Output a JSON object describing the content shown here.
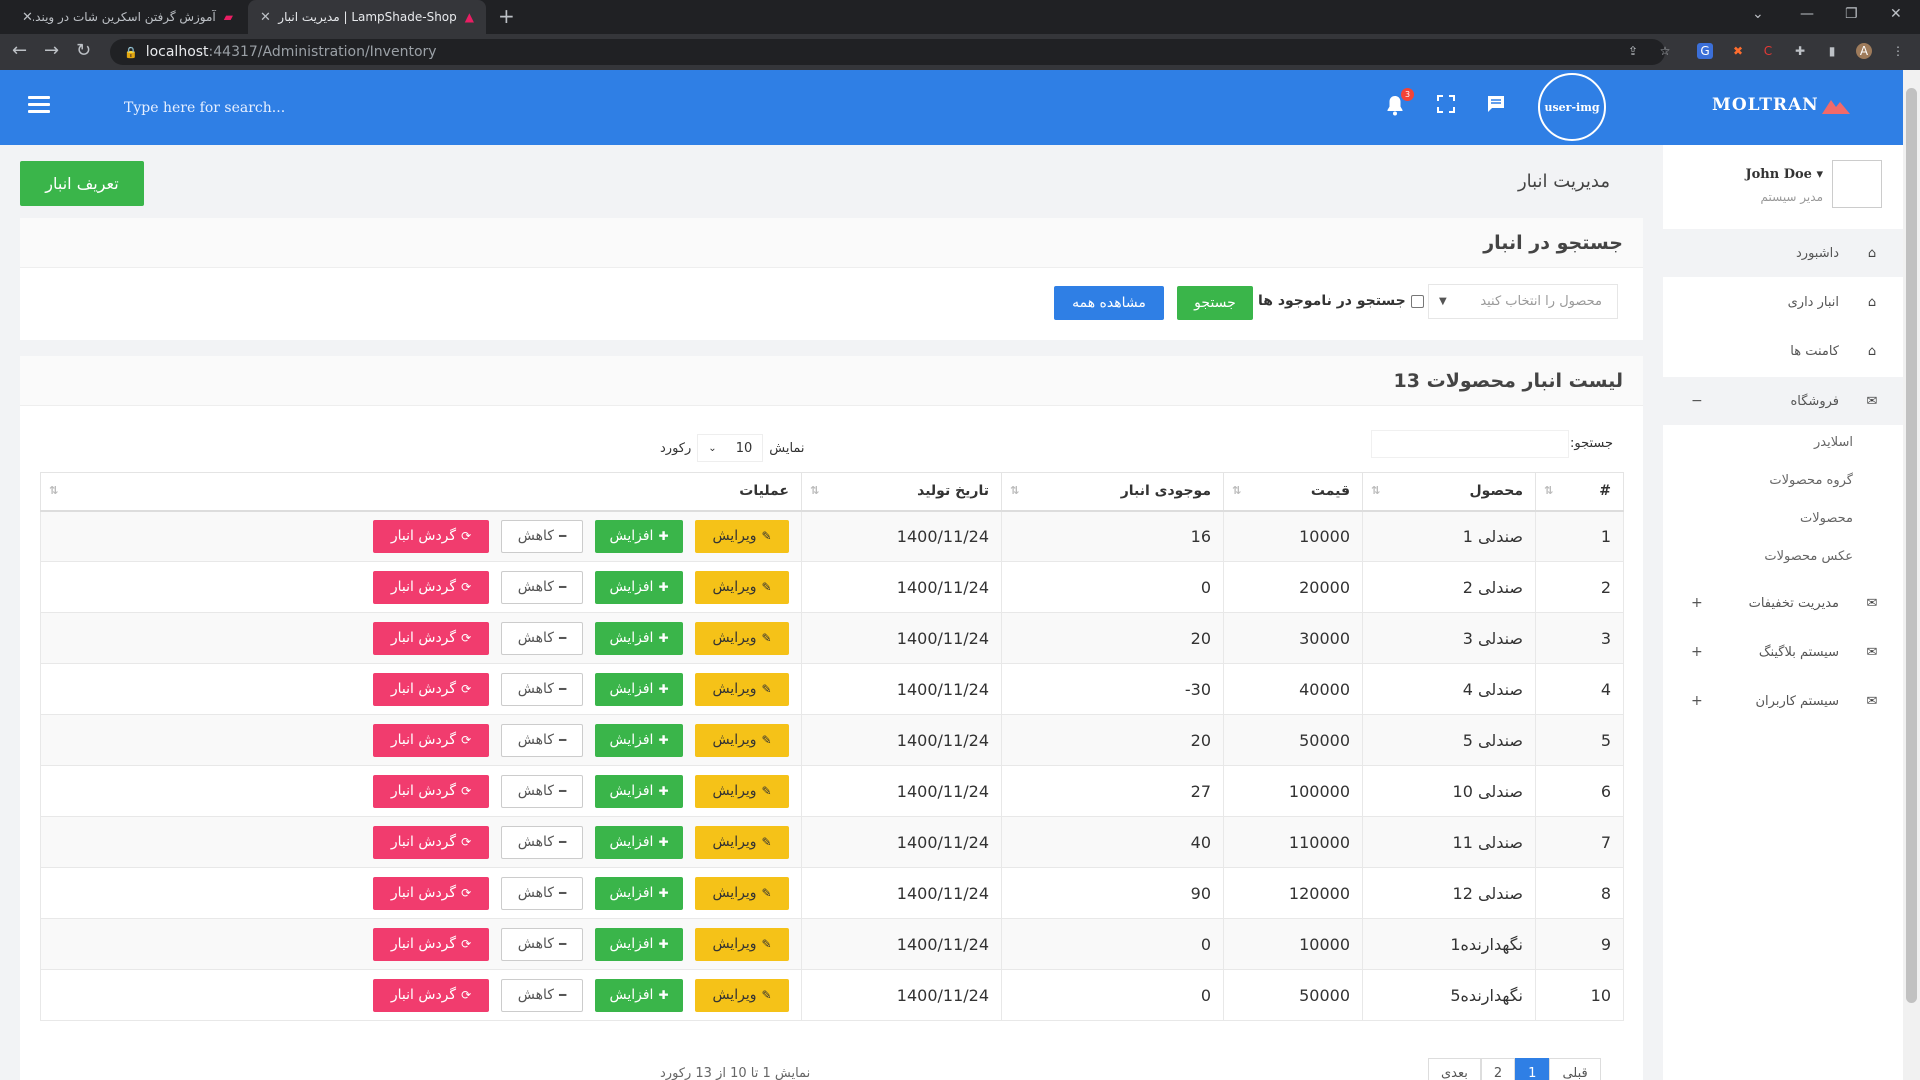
{
  "browser": {
    "tabs": [
      {
        "title": "آموزش گرفتن اسکرین شات در ویند..."
      },
      {
        "title": "LampShade-Shop | مدیریت انبار"
      }
    ],
    "url_host": "localhost",
    "url_path": ":44317/Administration/Inventory",
    "profile_initial": "A"
  },
  "header": {
    "search_placeholder": "Type here for search...",
    "notification_count": "3",
    "avatar_alt": "user-img",
    "brand": "MOLTRAN",
    "color": "#2f7fe5"
  },
  "sidebar": {
    "user_name": "John Doe",
    "user_role": "مدیر سیستم",
    "items": [
      {
        "label": "داشبورد",
        "icon": "home-icon"
      },
      {
        "label": "انبار داری",
        "icon": "home-icon"
      },
      {
        "label": "کامنت ها",
        "icon": "home-icon"
      },
      {
        "label": "فروشگاه",
        "icon": "envelope-icon",
        "toggle": "−"
      },
      {
        "label": "مدیریت تخفیفات",
        "icon": "envelope-icon",
        "toggle": "+"
      },
      {
        "label": "سیستم بلاگینگ",
        "icon": "envelope-icon",
        "toggle": "+"
      },
      {
        "label": "سیستم کاربران",
        "icon": "envelope-icon",
        "toggle": "+"
      }
    ],
    "shop_sub": [
      "اسلایدر",
      "گروه محصولات",
      "محصولات",
      "عکس محصولات"
    ]
  },
  "page": {
    "title": "مدیریت انبار",
    "define_button": "تعریف انبار"
  },
  "search_card": {
    "title": "جستجو در انبار",
    "product_select": "محصول را انتخاب کنید",
    "out_of_stock_label": "جستجو در ناموجود ها",
    "search_button": "جستجو",
    "show_all_button": "مشاهده همه"
  },
  "list_card": {
    "title": "لیست انبار محصولات 13",
    "search_label": "جستجو:",
    "show_label": "نمایش",
    "page_length": "10",
    "records_label": "رکورد",
    "columns": [
      "#",
      "محصول",
      "قیمت",
      "موجودی انبار",
      "تاریخ تولید",
      "عملیات"
    ],
    "actions": {
      "edit": "ویرایش",
      "increase": "افزایش",
      "decrease": "کاهش",
      "log": "گردش انبار"
    },
    "rows": [
      {
        "id": "1",
        "product": "صندلی 1",
        "price": "10000",
        "stock": "16",
        "date": "1400/11/24"
      },
      {
        "id": "2",
        "product": "صندلی 2",
        "price": "20000",
        "stock": "0",
        "date": "1400/11/24"
      },
      {
        "id": "3",
        "product": "صندلی 3",
        "price": "30000",
        "stock": "20",
        "date": "1400/11/24"
      },
      {
        "id": "4",
        "product": "صندلی 4",
        "price": "40000",
        "stock": "30-",
        "date": "1400/11/24"
      },
      {
        "id": "5",
        "product": "صندلی 5",
        "price": "50000",
        "stock": "20",
        "date": "1400/11/24"
      },
      {
        "id": "6",
        "product": "صندلی 10",
        "price": "100000",
        "stock": "27",
        "date": "1400/11/24"
      },
      {
        "id": "7",
        "product": "صندلی 11",
        "price": "110000",
        "stock": "40",
        "date": "1400/11/24"
      },
      {
        "id": "8",
        "product": "صندلی 12",
        "price": "120000",
        "stock": "90",
        "date": "1400/11/24"
      },
      {
        "id": "9",
        "product": "نگهدارنده1",
        "price": "10000",
        "stock": "0",
        "date": "1400/11/24"
      },
      {
        "id": "10",
        "product": "نگهدارنده5",
        "price": "50000",
        "stock": "0",
        "date": "1400/11/24"
      }
    ],
    "info": "نمایش 1 تا 10 از 13 رکورد",
    "pager": [
      "قبلی",
      "1",
      "2",
      "بعدی"
    ]
  }
}
